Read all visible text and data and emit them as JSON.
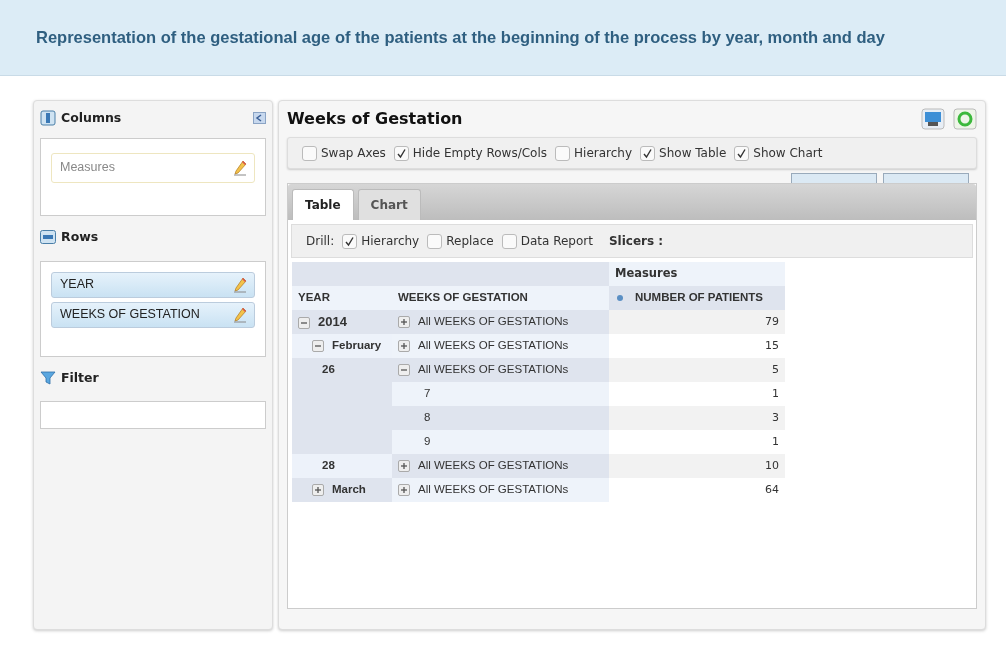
{
  "banner": {
    "title": "Representation of the gestational age of the patients at the beginning of the process by year, month and day"
  },
  "sidebar": {
    "columns": {
      "label": "Columns",
      "items": [
        {
          "label": "Measures",
          "kind": "measure"
        }
      ]
    },
    "rows": {
      "label": "Rows",
      "items": [
        {
          "label": "YEAR",
          "kind": "level"
        },
        {
          "label": "WEEKS OF GESTATION",
          "kind": "level"
        }
      ]
    },
    "filter": {
      "label": "Filter"
    }
  },
  "report": {
    "title": "Weeks of Gestation",
    "options": [
      {
        "label": "Swap Axes",
        "checked": false
      },
      {
        "label": "Hide Empty Rows/Cols",
        "checked": true
      },
      {
        "label": "Hierarchy",
        "checked": false
      },
      {
        "label": "Show Table",
        "checked": true
      },
      {
        "label": "Show Chart",
        "checked": true
      }
    ],
    "tabs": [
      {
        "label": "Table",
        "selected": true
      },
      {
        "label": "Chart",
        "selected": false
      }
    ],
    "drill": {
      "label": "Drill:",
      "options": [
        {
          "label": "Hierarchy",
          "checked": true
        },
        {
          "label": "Replace",
          "checked": false
        },
        {
          "label": "Data Report",
          "checked": false
        }
      ],
      "slicers": "Slicers :"
    },
    "table": {
      "measures_header": "Measures",
      "columns": [
        "YEAR",
        "WEEKS OF GESTATION",
        "NUMBER OF PATIENTS"
      ],
      "rows": [
        {
          "year": {
            "label": "2014",
            "expanded": true
          },
          "week": {
            "label": "All WEEKS OF GESTATIONs",
            "expanded": false
          },
          "value": "79"
        },
        {
          "year": {
            "label": "February",
            "expanded": true
          },
          "week": {
            "label": "All WEEKS OF GESTATIONs",
            "expanded": false
          },
          "value": "15"
        },
        {
          "year": {
            "label": "26"
          },
          "week": {
            "label": "All WEEKS OF GESTATIONs",
            "expanded": true
          },
          "value": "5"
        },
        {
          "week": {
            "label": "7"
          },
          "value": "1"
        },
        {
          "week": {
            "label": "8"
          },
          "value": "3"
        },
        {
          "week": {
            "label": "9"
          },
          "value": "1"
        },
        {
          "year": {
            "label": "28"
          },
          "week": {
            "label": "All WEEKS OF GESTATIONs",
            "expanded": false
          },
          "value": "10"
        },
        {
          "year": {
            "label": "March",
            "expanded": false
          },
          "week": {
            "label": "All WEEKS OF GESTATIONs",
            "expanded": false
          },
          "value": "64"
        }
      ]
    }
  }
}
